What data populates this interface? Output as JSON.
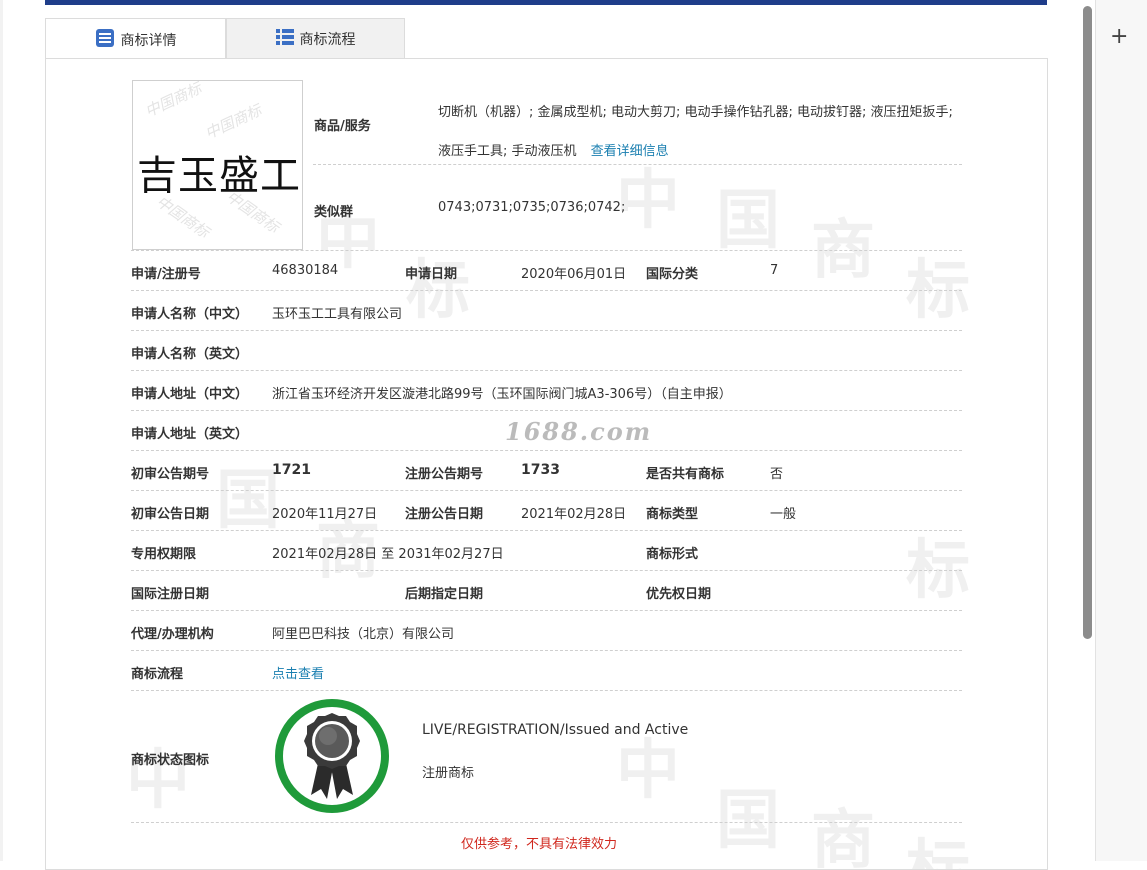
{
  "tabs": {
    "detail": "商标详情",
    "flow": "商标流程"
  },
  "logo": {
    "mark_text": "吉玉盛工",
    "watermark_text": "中国商标"
  },
  "goods": {
    "label": "商品/服务",
    "value": "切断机（机器）; 金属成型机; 电动大剪刀; 电动手操作钻孔器; 电动拔钉器; 液压扭矩扳手; 液压手工具; 手动液压机",
    "detail_link": "查看详细信息"
  },
  "similar_group": {
    "label": "类似群",
    "value": "0743;0731;0735;0736;0742;"
  },
  "fields": {
    "reg_no_label": "申请/注册号",
    "reg_no": "46830184",
    "apply_date_label": "申请日期",
    "apply_date": "2020年06月01日",
    "intl_class_label": "国际分类",
    "intl_class": "7",
    "applicant_cn_label": "申请人名称（中文）",
    "applicant_cn": "玉环玉工工具有限公司",
    "applicant_en_label": "申请人名称（英文）",
    "applicant_en": "",
    "address_cn_label": "申请人地址（中文）",
    "address_cn": "浙江省玉环经济开发区漩港北路99号（玉环国际阀门城A3-306号）（自主申报）",
    "address_en_label": "申请人地址（英文）",
    "address_en": "",
    "prelim_no_label": "初审公告期号",
    "prelim_no": "1721",
    "reg_pub_no_label": "注册公告期号",
    "reg_pub_no": "1733",
    "shared_label": "是否共有商标",
    "shared": "否",
    "prelim_date_label": "初审公告日期",
    "prelim_date": "2020年11月27日",
    "reg_pub_date_label": "注册公告日期",
    "reg_pub_date": "2021年02月28日",
    "type_label": "商标类型",
    "type": "一般",
    "exclusive_label": "专用权期限",
    "exclusive": "2021年02月28日 至 2031年02月27日",
    "form_label": "商标形式",
    "form": "",
    "intl_reg_date_label": "国际注册日期",
    "later_designation_label": "后期指定日期",
    "priority_date_label": "优先权日期",
    "agent_label": "代理/办理机构",
    "agent": "阿里巴巴科技（北京）有限公司",
    "flow_label": "商标流程",
    "flow_link": "点击查看",
    "status_icon_label": "商标状态图标"
  },
  "status": {
    "en": "LIVE/REGISTRATION/Issued and Active",
    "cn": "注册商标",
    "ring_color": "#1f9a3a"
  },
  "site_watermark": "1688.com",
  "background_watermark": "中国商标",
  "disclaimer": "仅供参考，不具有法律效力",
  "colors": {
    "link": "#1a7fb0",
    "disclaimer": "#d0271d",
    "topbar": "#1f3d8a"
  }
}
